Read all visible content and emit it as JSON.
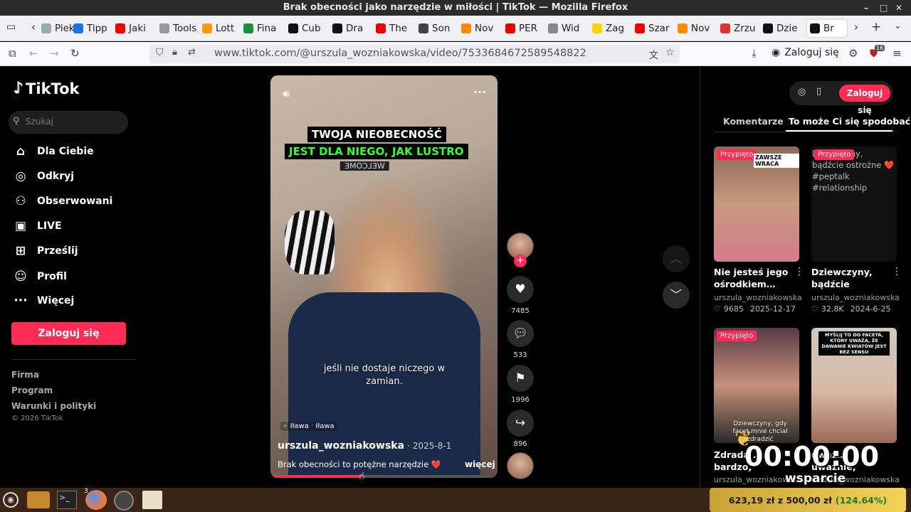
{
  "window": {
    "title": "Brak obecności jako narzędzie w miłości | TikTok — Mozilla Firefox",
    "minimize": "–",
    "maximize": "□",
    "close": "✕"
  },
  "tabs": [
    {
      "label": "Piek",
      "color": "#9aa"
    },
    {
      "label": "Tipp",
      "color": "#1a73e8"
    },
    {
      "label": "Jaki",
      "color": "#e00"
    },
    {
      "label": "Tools,",
      "color": "#999"
    },
    {
      "label": "Lott",
      "color": "#f90"
    },
    {
      "label": "Fina",
      "color": "#1a8f3c"
    },
    {
      "label": "Cub",
      "color": "#111"
    },
    {
      "label": "Dra",
      "color": "#111"
    },
    {
      "label": "The",
      "color": "#e00"
    },
    {
      "label": "Son",
      "color": "#444"
    },
    {
      "label": "Nov",
      "color": "#ff8a00"
    },
    {
      "label": "PER",
      "color": "#e00"
    },
    {
      "label": "Wid",
      "color": "#888"
    },
    {
      "label": "Zag",
      "color": "#ffd400"
    },
    {
      "label": "Szar",
      "color": "#e00"
    },
    {
      "label": "Nov",
      "color": "#ff8a00"
    },
    {
      "label": "Zrzu",
      "color": "#d33"
    },
    {
      "label": "Dzie",
      "color": "#111"
    },
    {
      "label": "Br",
      "color": "#111"
    }
  ],
  "nav": {
    "url": "www.tiktok.com/@urszula_wozniakowska/video/7533684672589548822",
    "login": "Zaloguj się",
    "badge": "16"
  },
  "sidebar": {
    "logo": "TikTok",
    "search_placeholder": "Szukaj",
    "items": [
      {
        "label": "Dla Ciebie",
        "icon": "⌂"
      },
      {
        "label": "Odkryj",
        "icon": "◎"
      },
      {
        "label": "Obserwowani",
        "icon": "⚇"
      },
      {
        "label": "LIVE",
        "icon": "▣"
      },
      {
        "label": "Prześlij",
        "icon": "⊞"
      },
      {
        "label": "Profil",
        "icon": "☺"
      },
      {
        "label": "Więcej",
        "icon": "···"
      }
    ],
    "login_button": "Zaloguj się",
    "footer": [
      "Firma",
      "Program",
      "Warunki i polityki"
    ],
    "copyright": "© 2026 TikTok"
  },
  "video": {
    "headline1": "TWOJA NIEOBECNOŚĆ",
    "headline2": "JEST DLA NIEGO, JAK LUSTRO",
    "welcome": "WELCOME",
    "subtitle": "jeśli nie dostaje niczego w zamian.",
    "location": "Iława · Iława",
    "author": "urszula_wozniakowska",
    "date": "2025-8-1",
    "description": "Brak obecności to potężne narzędzie ❤️ ...",
    "more": "więcej",
    "progress": 0.4
  },
  "actions": {
    "likes": "7485",
    "comments": "533",
    "saves": "1996",
    "shares": "896"
  },
  "right": {
    "tab_comments": "Komentarze",
    "tab_suggest": "To może Ci się spodobać",
    "login": "Zaloguj się",
    "cards": [
      {
        "pinned": "Przypięto",
        "overlay": "ZAWSZE WRACA",
        "title": "Nie jesteś jego ośrodkiem…",
        "author": "urszula_wozniakowska",
        "views": "9685",
        "date": "2025-12-17"
      },
      {
        "pinned": "Przypięto",
        "overlay": "Dziewczyny, bądźcie ostrożne ❤️ #peptalk #relationship",
        "title": "Dziewczyny, bądźcie ostrożne…",
        "author": "urszula_wozniakowska",
        "views": "32.8K",
        "date": "2024-6-25"
      },
      {
        "pinned": "Przypięto",
        "overlay": "Dziewczyny, gdy facet mnie chciał zdradzić",
        "title": "Zdrada... bardzo, potrzym…",
        "author": "urszula_wozniakowska",
        "views": "",
        "date": ""
      },
      {
        "pinned": "",
        "overlay": "MYŚLIJ TO DO FACETA, KTÓRY UWAŻA, ŻE DAWANIE KWIATÓW JEST BEZ SENSU",
        "title": "uważ…, uważnie, pamowi…",
        "author": "urszula_wozniakowska",
        "views": "",
        "date": ""
      }
    ]
  },
  "overlay": {
    "timer": "00:00:00",
    "label": "wsparcie"
  },
  "taskbar": {
    "donation": "623,19 zł z 500,00 zł",
    "percent": "(124.64%)",
    "badge": "3"
  }
}
